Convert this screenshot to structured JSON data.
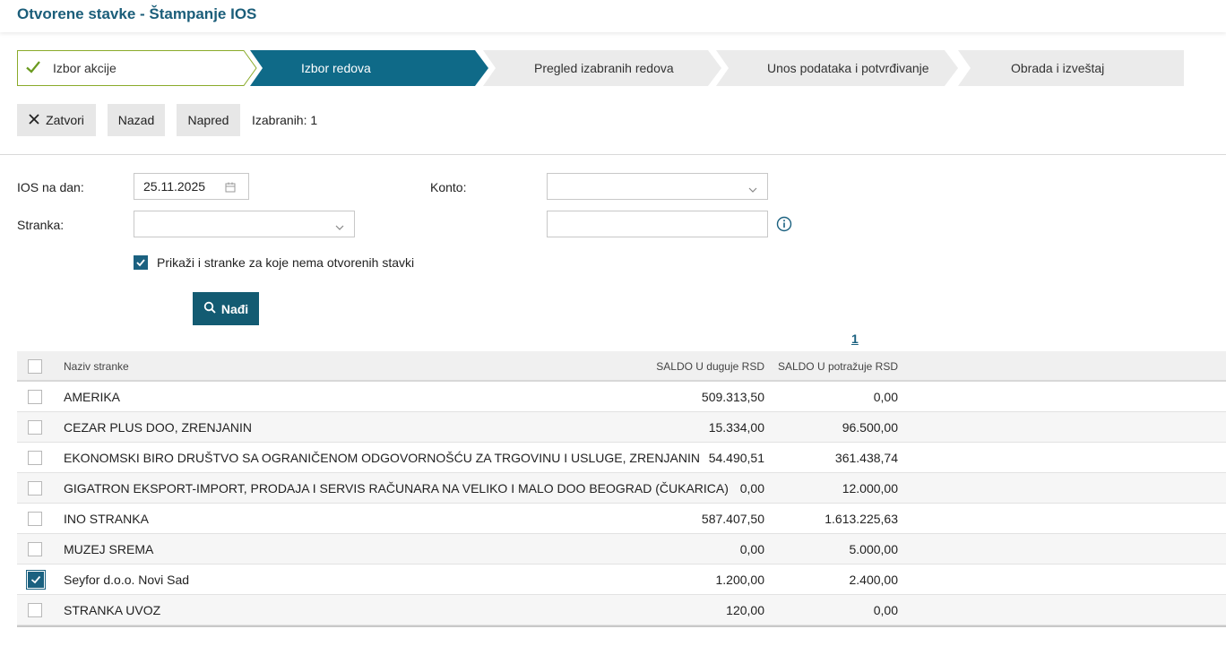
{
  "header": {
    "title": "Otvorene stavke - Štampanje IOS"
  },
  "steps": [
    {
      "label": "Izbor akcije",
      "state": "done"
    },
    {
      "label": "Izbor redova",
      "state": "active"
    },
    {
      "label": "Pregled izabranih redova",
      "state": "pending"
    },
    {
      "label": "Unos podataka i potvrđivanje",
      "state": "pending"
    },
    {
      "label": "Obrada i izveštaj",
      "state": "pending"
    }
  ],
  "toolbar": {
    "close_label": "Zatvori",
    "back_label": "Nazad",
    "next_label": "Napred",
    "selected_label": "Izabranih: 1"
  },
  "form": {
    "ios_date_label": "IOS na dan:",
    "ios_date_value": "25.11.2025",
    "konto_label": "Konto:",
    "konto_value": "",
    "stranka_label": "Stranka:",
    "stranka_value": "",
    "text_value": "",
    "show_all_label": "Prikaži i stranke za koje nema otvorenih stavki",
    "show_all_checked": true,
    "search_label": "Nađi"
  },
  "pagination": {
    "current_page": "1"
  },
  "table": {
    "columns": [
      "Naziv stranke",
      "SALDO U duguje RSD",
      "SALDO U potražuje RSD"
    ],
    "rows": [
      {
        "name": "AMERIKA",
        "debit": "509.313,50",
        "credit": "0,00",
        "checked": false
      },
      {
        "name": "CEZAR PLUS DOO, ZRENJANIN",
        "debit": "15.334,00",
        "credit": "96.500,00",
        "checked": false
      },
      {
        "name": "EKONOMSKI BIRO DRUŠTVO SA OGRANIČENOM ODGOVORNOŠĆU ZA TRGOVINU I USLUGE, ZRENJANIN",
        "debit": "54.490,51",
        "credit": "361.438,74",
        "checked": false
      },
      {
        "name": "GIGATRON EKSPORT-IMPORT, PRODAJA I SERVIS RAČUNARA NA VELIKO I MALO DOO BEOGRAD (ČUKARICA)",
        "debit": "0,00",
        "credit": "12.000,00",
        "checked": false
      },
      {
        "name": "INO STRANKA",
        "debit": "587.407,50",
        "credit": "1.613.225,63",
        "checked": false
      },
      {
        "name": "MUZEJ SREMA",
        "debit": "0,00",
        "credit": "5.000,00",
        "checked": false
      },
      {
        "name": "Seyfor d.o.o. Novi Sad",
        "debit": "1.200,00",
        "credit": "2.400,00",
        "checked": true
      },
      {
        "name": "STRANKA UVOZ",
        "debit": "120,00",
        "credit": "0,00",
        "checked": false
      }
    ]
  },
  "colors": {
    "accent": "#1b6180",
    "done_border": "#8aab2a",
    "check_green": "#6a9a1f"
  }
}
